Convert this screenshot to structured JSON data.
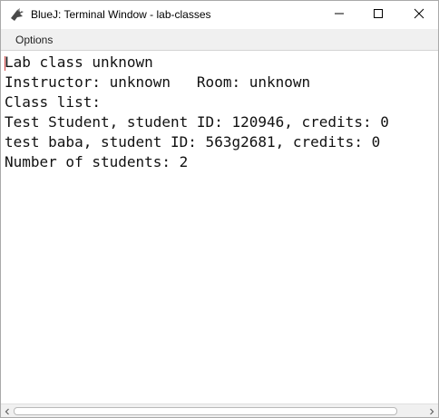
{
  "window": {
    "title": "BlueJ: Terminal Window - lab-classes"
  },
  "menu": {
    "items": [
      "Options"
    ]
  },
  "terminal": {
    "lines": [
      "Lab class unknown",
      "Instructor: unknown   Room: unknown",
      "Class list:",
      "Test Student, student ID: 120946, credits: 0",
      "test baba, student ID: 563g2681, credits: 0",
      "Number of students: 2"
    ]
  },
  "icons": {
    "app": "bluej-bird-icon",
    "minimize": "minimize-icon",
    "maximize": "maximize-icon",
    "close": "close-icon",
    "scroll_left": "chevron-left-icon",
    "scroll_right": "chevron-right-icon"
  }
}
